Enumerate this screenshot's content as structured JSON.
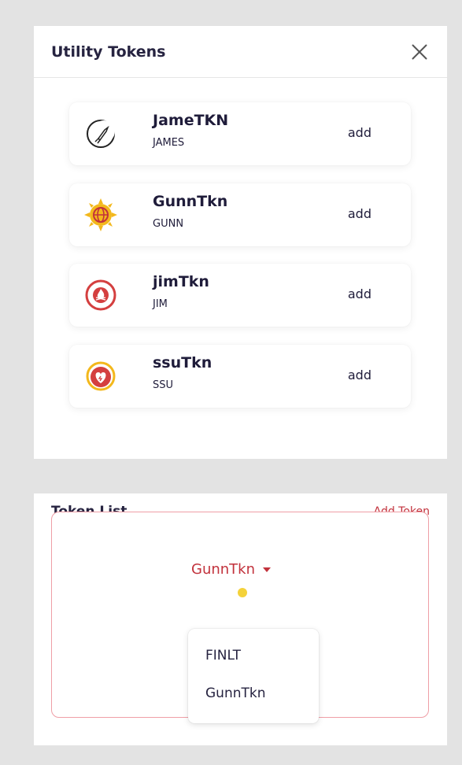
{
  "modal": {
    "title": "Utility Tokens",
    "close_icon": "close-icon"
  },
  "tokens": [
    {
      "name": "JameTKN",
      "symbol": "JAMES",
      "action": "add",
      "icon": "crescent-rocket-icon"
    },
    {
      "name": "GunnTkn",
      "symbol": "GUNN",
      "action": "add",
      "icon": "sun-globe-icon"
    },
    {
      "name": "jimTkn",
      "symbol": "JIM",
      "action": "add",
      "icon": "fire-circle-icon"
    },
    {
      "name": "ssuTkn",
      "symbol": "SSU",
      "action": "add",
      "icon": "heart-circle-icon"
    }
  ],
  "token_list": {
    "title": "Token List",
    "add_label": "Add Token",
    "selected": "GunnTkn",
    "options": [
      "FINLT",
      "GunnTkn"
    ]
  },
  "colors": {
    "accent": "#c2323c",
    "text": "#1f1c3a",
    "background": "#e3e3e3",
    "border": "#ef9ea6"
  }
}
